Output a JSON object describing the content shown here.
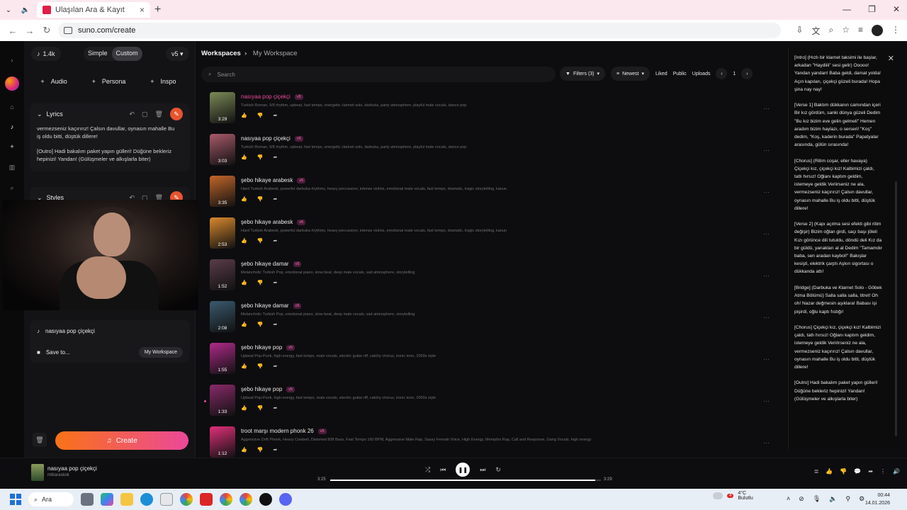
{
  "browser": {
    "tab_title": "Ulaşılan Ara & Kayıt",
    "url": "suno.com/create"
  },
  "panel": {
    "credits": "1.4k",
    "mode_simple": "Simple",
    "mode_custom": "Custom",
    "version": "v5",
    "add_audio": "Audio",
    "add_persona": "Persona",
    "add_inspo": "Inspo",
    "lyrics_label": "Lyrics",
    "lyrics_preview_1": "vermezseniz kaçırırız! Çalsın davullar, oynasın mahalle Bu iş oldu bitti, düştük dillere!",
    "lyrics_preview_2": "[Outro] Hadi bakalım paket yapın gülleri! Düğüne bekleriz hepinizi! Yandan! (Gülüşmeler ve alkışlarla biter)",
    "styles_label": "Styles",
    "song_title_value": "nasıyaa pop çiçekçi",
    "save_to_label": "Save to...",
    "workspace_pill": "My Workspace",
    "create_label": "Create"
  },
  "main": {
    "breadcrumb_root": "Workspaces",
    "breadcrumb_current": "My Workspace",
    "search_placeholder": "Search",
    "filters_label": "Filters (3)",
    "sort_label": "Newest",
    "liked_label": "Liked",
    "public_label": "Public",
    "uploads_label": "Uploads",
    "page_number": "1"
  },
  "songs": [
    {
      "title": "nasıyaa pop çiçekçi",
      "version": "v5",
      "duration": "3:29",
      "tags": "Turkish Roman, 9/8 rhythm, upbeat, fast tempo, energetic clarinet solo, darbuka, party atmosphere, playful male vocals, dance pop",
      "playing": true,
      "thumb_color": "#7b8a56"
    },
    {
      "title": "nasıyaa pop çiçekçi",
      "version": "v5",
      "duration": "3:03",
      "tags": "Turkish Roman, 9/8 rhythm, upbeat, fast tempo, energetic clarinet solo, darbuka, party atmosphere, playful male vocals, dance pop",
      "playing": false,
      "thumb_color": "#a85a6a"
    },
    {
      "title": "şebo hikaye arabesk",
      "version": "v5",
      "duration": "3:35",
      "tags": "Hard Turkish Arabesk, powerful darbuka rhythms, heavy percussion, intense violins, emotional male vocals, fast tempo, dramatic, tragic storytelling, kanun",
      "playing": false,
      "thumb_color": "#c2662a"
    },
    {
      "title": "şebo hikaye arabesk",
      "version": "v5",
      "duration": "2:53",
      "tags": "Hard Turkish Arabesk, powerful darbuka rhythms, heavy percussion, intense violins, emotional male vocals, fast tempo, dramatic, tragic storytelling, kanun",
      "playing": false,
      "thumb_color": "#d9892e"
    },
    {
      "title": "şebo hikaye damar",
      "version": "v5",
      "duration": "1:52",
      "tags": "Melancholic Turkish Pop, emotional piano, slow beat, deep male vocals, sad atmosphere, storytelling",
      "playing": false,
      "thumb_color": "#5a3c48"
    },
    {
      "title": "şebo hikaye damar",
      "version": "v5",
      "duration": "2:08",
      "tags": "Melancholic Turkish Pop, emotional piano, slow beat, deep male vocals, sad atmosphere, storytelling",
      "playing": false,
      "thumb_color": "#3a5a6e"
    },
    {
      "title": "şebo hikaye pop",
      "version": "v5",
      "duration": "1:55",
      "tags": "Upbeat Pop-Punk, high energy, fast tempo, male vocals, electric guitar riff, catchy chorus, ironic tone, 2000s style",
      "playing": false,
      "thumb_color": "#b02a8a"
    },
    {
      "title": "şebo hikaye pop",
      "version": "v5",
      "duration": "1:33",
      "tags": "Upbeat Pop-Punk, high energy, fast tempo, male vocals, electric guitar riff, catchy chorus, ironic tone, 2000s style",
      "playing": false,
      "thumb_color": "#8a2a6a"
    },
    {
      "title": "troot marşı modern phonk 26",
      "version": "v5",
      "duration": "1:12",
      "tags": "Aggressive Drift Phonk, Heavy Cowbell, Distorted 808 Bass, Fast Tempo 160 BPM, Aggressive Male Rap, Sassy Female Voice, High Energy, Memphis Rap, Call and Response, Gang Vocals, high energy",
      "playing": false,
      "thumb_color": "#e0307a"
    }
  ],
  "lyrics_pane": {
    "text": "[Intro] (Hızlı bir klarnet taksimi ile başlar, arkadan \"Haydiiii\" sesi gelir) Ooooo! Yandan yandan! Baba geldi, damat yolda! Açın kapıları, çiçekçi güzeli burada! Hopa şina nay nay!\n\n[Verse 1] Baktım dükkanın camından içeri Bir kız gördüm, sanki dünya güzeli Dedim \"Bu kız bizim eve gelin gelmeli\" Hemen aradım bizim haylazı, o serseri! \"Koş\" dedim, \"Koş, kaderin burada\" Papatyalar arasında, gülün sırasında!\n\n[Chorus] (Ritim coşar, eller havaya) Çiçekçi kız, çiçekçi kız! Kalbimizi çaldı, tatlı hırsız! Oğlanı kaptım geldim, istemeye geldik Veriirseniz ne ala, vermezseniz kaçırırız! Çalsın davullar, oynasın mahalle Bu iş oldu bitti, düştük dillere!\n\n[Verse 2] (Kapı açılma sesi efekti gibi ritim değişir) Bizim oğlan girdi, saçı başı jöleli Kızı görünce dili tutuldu, döndü deli Kız da bir güldü, yanakları al al Dedim \"Tamamdır baba, sen aradan kaybol!\" Bakışlar kesişti, elektrik çarptı Aşkın sigortası o dükkanda attı!\n\n[Bridge] (Darbuka ve Klarnet Solo - Göbek Atma Bölümü) Salla salla salla, titret! Oh oh! Nazar değmesin aşıklara! Babası işi pişirdi, oğlu kaptı fısbğı!\n\n[Chorus] Çiçekçi kız, çiçekçi kız! Kalbimizi çaldı, tatlı hırsız! Oğlanı kaptım geldim, istemeye geldik Veririrseniz ne ala, vermezseniz kaçırırız! Çalsın davullar, oynasın mahalle Bu iş oldu bitti, düştük dillere!\n\n[Outro] Hadi bakalım paket yapın gülleri! Düğüne bekleriz hepinizi! Yandan! (Gülüşmeler ve alkışlarla biter)"
  },
  "player": {
    "title": "nasıyaa pop çiçekçi",
    "artist": "mtkaraskok",
    "current_time": "3:25",
    "total_time": "3:29",
    "progress": 0.98
  },
  "taskbar": {
    "search_label": "Ara",
    "temperature": "4°C",
    "weather": "Bulutlu",
    "weather_badge": "4",
    "time": "00:44",
    "date": "14.01.2026"
  },
  "colors": {
    "accent_pink": "#ec4899",
    "create_gradient_start": "#f97316",
    "create_gradient_end": "#ec4899"
  }
}
